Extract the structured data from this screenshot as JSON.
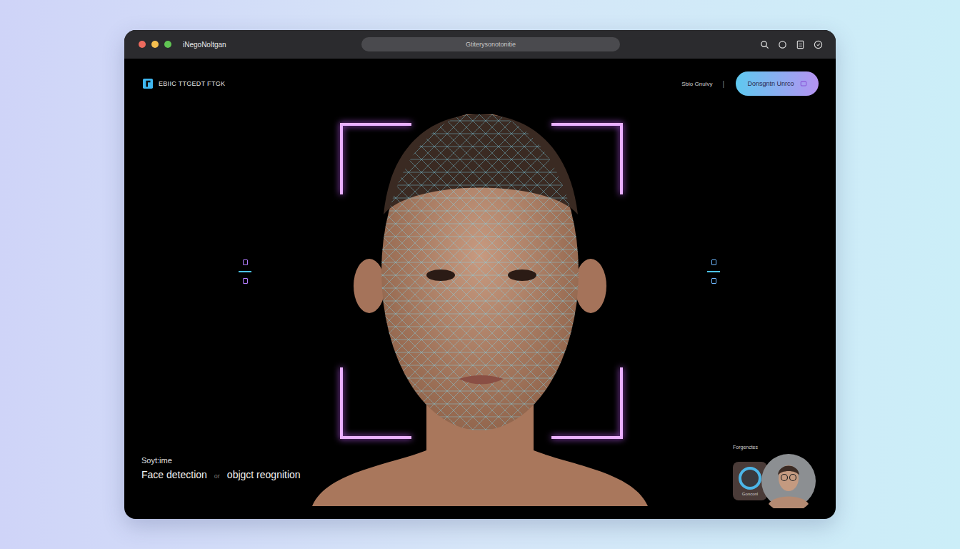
{
  "window": {
    "title": "iNegoNoltgan",
    "traffic_lights": [
      {
        "color": "#ed6a5e"
      },
      {
        "color": "#f5bf4f"
      },
      {
        "color": "#61c554"
      }
    ]
  },
  "address_bar": {
    "url": "Gtiterysonotonitie"
  },
  "header": {
    "logo": "EBIIC TTGEDT FTGK",
    "nav_link": "Sbio Gnulvy",
    "separator": "|",
    "cta": "Donsgntn Unrco"
  },
  "hero": {
    "eyebrow": "Soyt:ime",
    "caption": [
      {
        "text": "Face detection",
        "muted": false
      },
      {
        "text": "or",
        "muted": true
      },
      {
        "text": "objgct reognition",
        "muted": false
      }
    ]
  },
  "preview": {
    "label": "Forgenctes",
    "thumb_label": "Gonconl"
  }
}
